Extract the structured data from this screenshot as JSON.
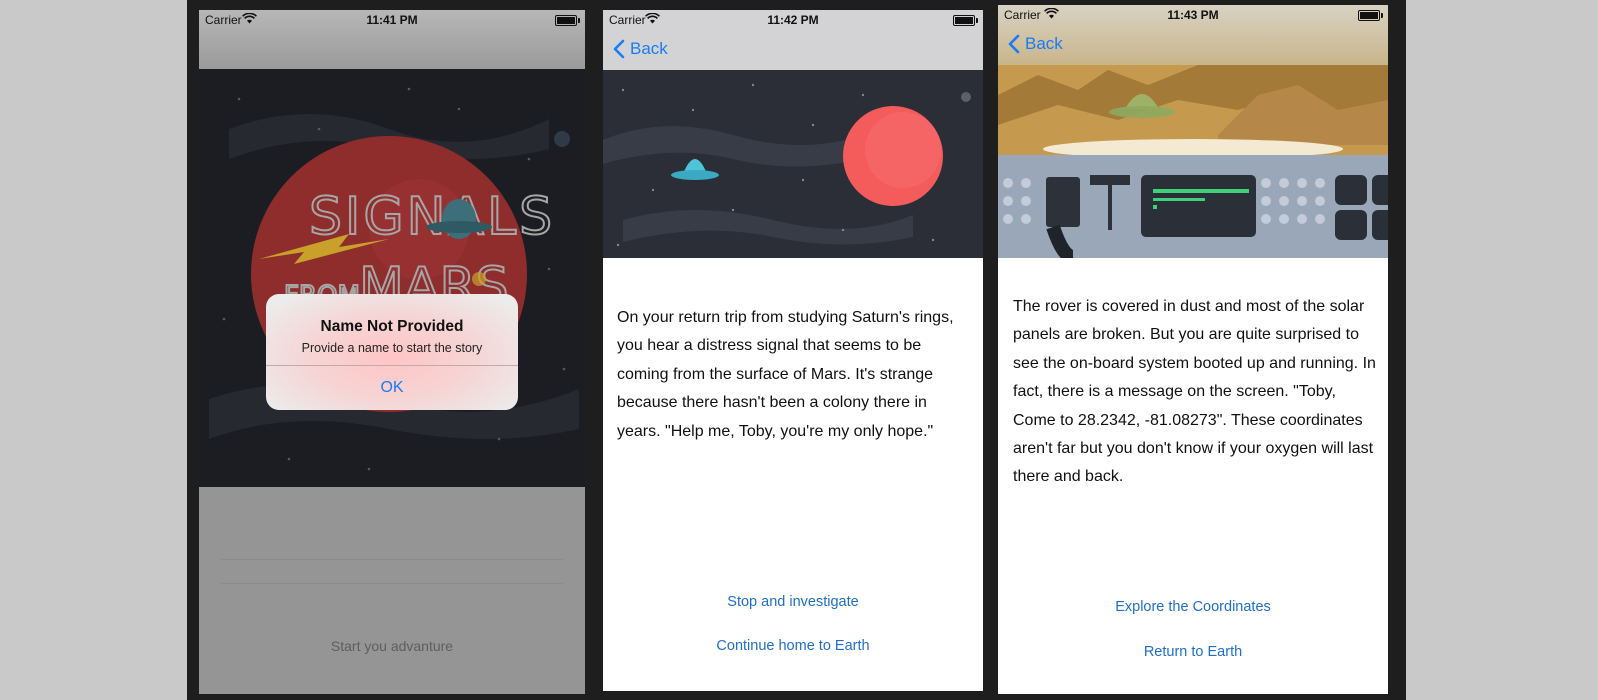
{
  "screens": [
    {
      "status": {
        "carrier": "Carrier",
        "time": "11:41 PM"
      },
      "alert": {
        "title": "Name Not Provided",
        "message": "Provide a name to start the story",
        "ok_label": "OK"
      },
      "start_button_label": "Start you advanture"
    },
    {
      "status": {
        "carrier": "Carrier",
        "time": "11:42 PM"
      },
      "back_label": "Back",
      "story_text": "On your return trip from studying Saturn's rings, you hear a distress signal that seems to be coming from the surface of Mars. It's strange because there hasn't been a colony there in years. \"Help me, Toby, you're my only hope.\"",
      "choices": [
        "Stop and investigate",
        "Continue home to Earth"
      ]
    },
    {
      "status": {
        "carrier": "Carrier",
        "time": "11:43 PM"
      },
      "back_label": "Back",
      "story_text": "The rover is covered in dust and most of the solar panels are broken. But you are quite surprised to see the on-board system booted up and running. In fact, there is a message on the screen. \"Toby, Come to 28.2342, -81.08273\". These coordinates aren't far but you don't know if your oxygen will last there and back.",
      "choices": [
        "Explore the Coordinates",
        "Return to Earth"
      ]
    }
  ],
  "icons": [
    "wifi-icon",
    "battery-icon",
    "chevron-left-icon",
    "ufo-icon",
    "planet-icon"
  ],
  "colors": {
    "accent": "#1a7cf2",
    "link": "#1f6fc9",
    "mars": "#f45b5b",
    "ufo": "#4fc3d9"
  }
}
